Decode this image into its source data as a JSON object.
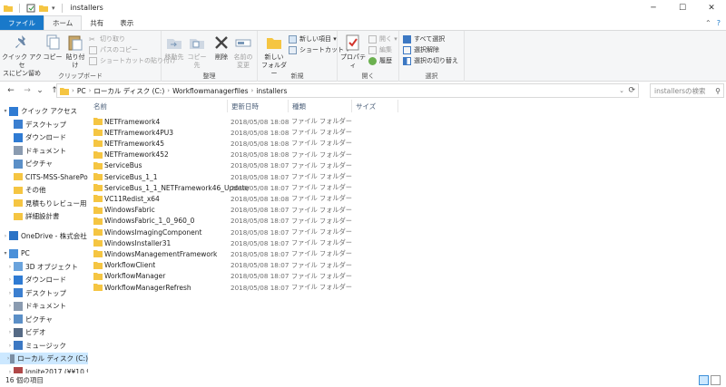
{
  "window": {
    "title": "installers",
    "minimize": "─",
    "maximize": "☐",
    "close": "✕"
  },
  "tabs": {
    "file": "ファイル",
    "home": "ホーム",
    "share": "共有",
    "view": "表示",
    "collapse": "⌃",
    "help": "?"
  },
  "ribbon": {
    "clipboard": {
      "label": "クリップボード",
      "pin": "クイック アクセ\nスにピン留め",
      "copy": "コピー",
      "paste": "貼り付け",
      "cut": "切り取り",
      "copy_path": "パスのコピー",
      "paste_shortcut": "ショートカットの貼り付け"
    },
    "organize": {
      "label": "整理",
      "move_to": "移動先",
      "copy_to": "コピー先",
      "delete": "削除",
      "rename": "名前の\n変更"
    },
    "new": {
      "label": "新規",
      "new_folder": "新しい\nフォルダー",
      "new_item": "新しい項目 ▾",
      "shortcut": "ショートカット ▾"
    },
    "open": {
      "label": "開く",
      "properties": "プロパティ",
      "open": "開く ▾",
      "edit": "編集",
      "history": "履歴"
    },
    "select": {
      "label": "選択",
      "select_all": "すべて選択",
      "select_none": "選択解除",
      "invert": "選択の切り替え"
    }
  },
  "address": {
    "back": "←",
    "forward": "→",
    "recent": "⌄",
    "up": "↑",
    "crumbs": [
      "PC",
      "ローカル ディスク (C:)",
      "Workflowmanagerfiles",
      "installers"
    ],
    "search_placeholder": "installersの検索"
  },
  "nav": [
    {
      "label": "クイック アクセス",
      "icon": "star-icon",
      "level": 0,
      "exp": "▾",
      "pin": ""
    },
    {
      "label": "デスクトップ",
      "icon": "desktop-icon",
      "level": 1,
      "exp": "",
      "pin": "📌"
    },
    {
      "label": "ダウンロード",
      "icon": "download-icon",
      "level": 1,
      "exp": "",
      "pin": "📌"
    },
    {
      "label": "ドキュメント",
      "icon": "document-icon",
      "level": 1,
      "exp": "",
      "pin": "📌"
    },
    {
      "label": "ピクチャ",
      "icon": "picture-icon",
      "level": 1,
      "exp": "",
      "pin": "📌"
    },
    {
      "label": "CITS-MSS-SharePoi",
      "icon": "folder-icon",
      "level": 1,
      "exp": "",
      "pin": ""
    },
    {
      "label": "その他",
      "icon": "folder-icon",
      "level": 1,
      "exp": "",
      "pin": ""
    },
    {
      "label": "見積もりレビュー用",
      "icon": "folder-icon",
      "level": 1,
      "exp": "",
      "pin": ""
    },
    {
      "label": "詳細設計書",
      "icon": "folder-icon",
      "level": 1,
      "exp": "",
      "pin": ""
    },
    {
      "label": "OneDrive - 株式会社",
      "icon": "cloud-icon",
      "level": 0,
      "exp": "›",
      "pin": ""
    },
    {
      "label": "PC",
      "icon": "pc-icon",
      "level": 0,
      "exp": "▾",
      "pin": ""
    },
    {
      "label": "3D オブジェクト",
      "icon": "cube-icon",
      "level": 1,
      "exp": "›",
      "pin": ""
    },
    {
      "label": "ダウンロード",
      "icon": "download-icon",
      "level": 1,
      "exp": "›",
      "pin": ""
    },
    {
      "label": "デスクトップ",
      "icon": "desktop-icon",
      "level": 1,
      "exp": "›",
      "pin": ""
    },
    {
      "label": "ドキュメント",
      "icon": "document-icon",
      "level": 1,
      "exp": "›",
      "pin": ""
    },
    {
      "label": "ピクチャ",
      "icon": "picture-icon",
      "level": 1,
      "exp": "›",
      "pin": ""
    },
    {
      "label": "ビデオ",
      "icon": "video-icon",
      "level": 1,
      "exp": "›",
      "pin": ""
    },
    {
      "label": "ミュージック",
      "icon": "music-icon",
      "level": 1,
      "exp": "›",
      "pin": ""
    },
    {
      "label": "ローカル ディスク (C:)",
      "icon": "disk-icon",
      "level": 1,
      "exp": "›",
      "pin": "",
      "selected": true
    },
    {
      "label": "Ignite2017 (¥¥10.9",
      "icon": "network-drive-icon",
      "level": 1,
      "exp": "›",
      "pin": ""
    }
  ],
  "columns": {
    "name": "名前",
    "date": "更新日時",
    "type": "種類",
    "size": "サイズ"
  },
  "files": [
    {
      "name": "NETFramework4",
      "date": "2018/05/08 18:08",
      "type": "ファイル フォルダー"
    },
    {
      "name": "NETFramework4PU3",
      "date": "2018/05/08 18:08",
      "type": "ファイル フォルダー"
    },
    {
      "name": "NETFramework45",
      "date": "2018/05/08 18:08",
      "type": "ファイル フォルダー"
    },
    {
      "name": "NETFramework452",
      "date": "2018/05/08 18:08",
      "type": "ファイル フォルダー"
    },
    {
      "name": "ServiceBus",
      "date": "2018/05/08 18:07",
      "type": "ファイル フォルダー"
    },
    {
      "name": "ServiceBus_1_1",
      "date": "2018/05/08 18:07",
      "type": "ファイル フォルダー"
    },
    {
      "name": "ServiceBus_1_1_NETFramework46_Update",
      "date": "2018/05/08 18:07",
      "type": "ファイル フォルダー"
    },
    {
      "name": "VC11Redist_x64",
      "date": "2018/05/08 18:08",
      "type": "ファイル フォルダー"
    },
    {
      "name": "WindowsFabric",
      "date": "2018/05/08 18:07",
      "type": "ファイル フォルダー"
    },
    {
      "name": "WindowsFabric_1_0_960_0",
      "date": "2018/05/08 18:07",
      "type": "ファイル フォルダー"
    },
    {
      "name": "WindowsImagingComponent",
      "date": "2018/05/08 18:07",
      "type": "ファイル フォルダー"
    },
    {
      "name": "WindowsInstaller31",
      "date": "2018/05/08 18:07",
      "type": "ファイル フォルダー"
    },
    {
      "name": "WindowsManagementFramework",
      "date": "2018/05/08 18:07",
      "type": "ファイル フォルダー"
    },
    {
      "name": "WorkflowClient",
      "date": "2018/05/08 18:07",
      "type": "ファイル フォルダー"
    },
    {
      "name": "WorkflowManager",
      "date": "2018/05/08 18:07",
      "type": "ファイル フォルダー"
    },
    {
      "name": "WorkflowManagerRefresh",
      "date": "2018/05/08 18:07",
      "type": "ファイル フォルダー"
    }
  ],
  "status": {
    "count": "16 個の項目"
  },
  "colors": {
    "accent": "#1979ca",
    "folder": "#f5c542",
    "selection": "#cce8ff"
  }
}
